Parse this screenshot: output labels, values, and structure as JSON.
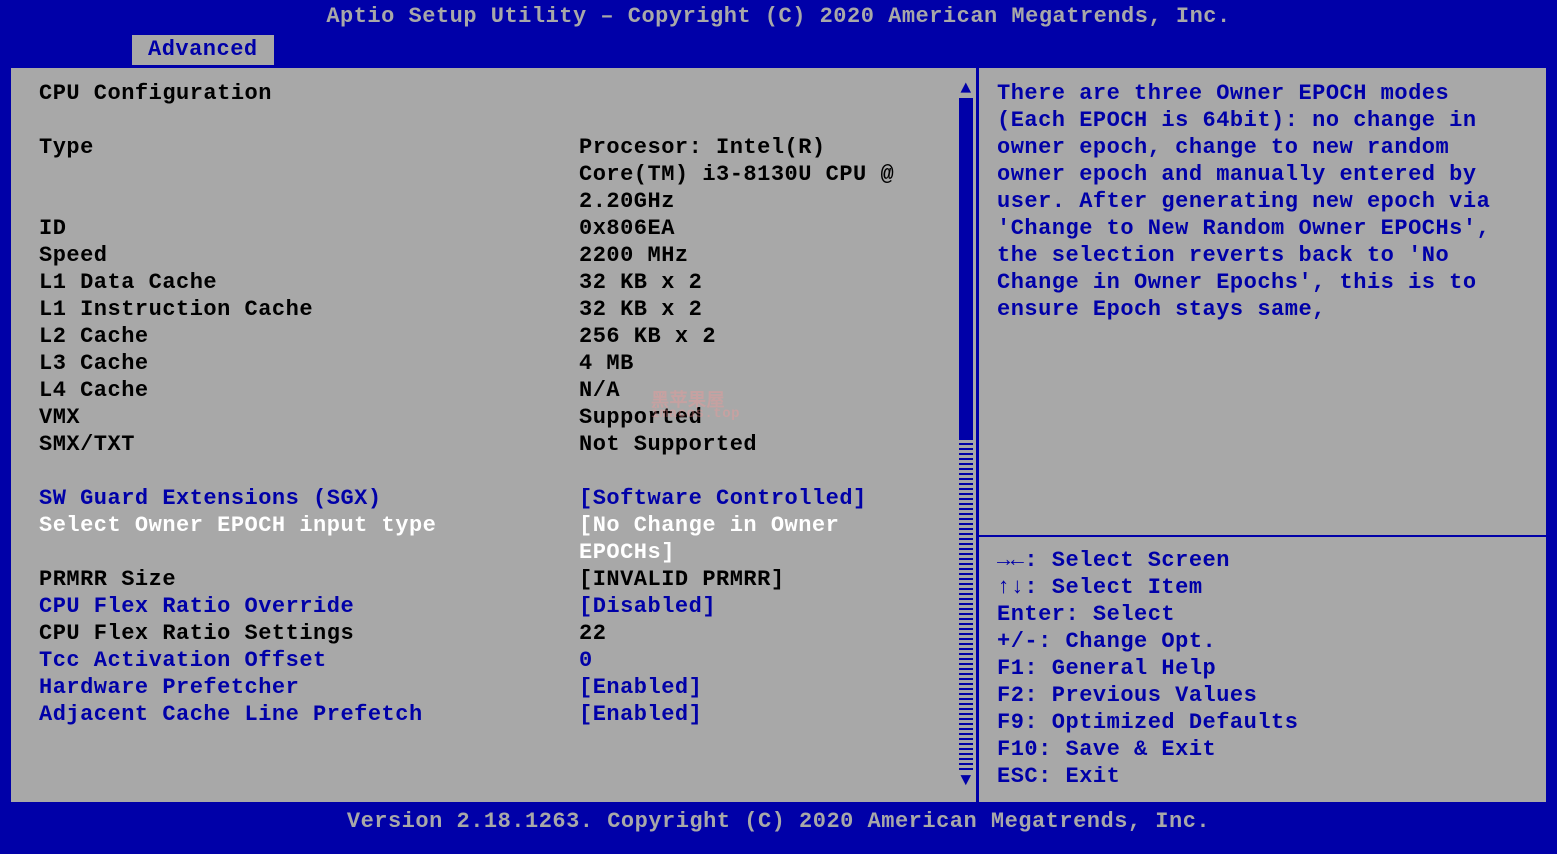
{
  "header": {
    "title": "Aptio Setup Utility – Copyright (C) 2020 American Megatrends, Inc."
  },
  "tab": {
    "active": "Advanced"
  },
  "main": {
    "section_title": "CPU Configuration",
    "info": [
      {
        "label": "Type",
        "value": "Procesor: Intel(R)"
      },
      {
        "label": "",
        "value": "Core(TM) i3-8130U CPU @"
      },
      {
        "label": "",
        "value": "2.20GHz"
      },
      {
        "label": "ID",
        "value": "0x806EA"
      },
      {
        "label": "Speed",
        "value": "2200 MHz"
      },
      {
        "label": "L1 Data Cache",
        "value": "32 KB x 2"
      },
      {
        "label": "L1 Instruction Cache",
        "value": "32 KB x 2"
      },
      {
        "label": "L2 Cache",
        "value": "256 KB x 2"
      },
      {
        "label": "L3 Cache",
        "value": "4 MB"
      },
      {
        "label": "L4 Cache",
        "value": "N/A"
      },
      {
        "label": "VMX",
        "value": "Supported"
      },
      {
        "label": "SMX/TXT",
        "value": "Not Supported"
      }
    ],
    "options": [
      {
        "label": "SW Guard Extensions (SGX)",
        "value": "[Software Controlled]",
        "kind": "option"
      },
      {
        "label": "Select Owner EPOCH input type",
        "value": "[No Change in Owner",
        "kind": "selected"
      },
      {
        "label": "",
        "value": "EPOCHs]",
        "kind": "selected"
      },
      {
        "label": "PRMRR Size",
        "value": "[INVALID PRMRR]",
        "kind": "readonly"
      },
      {
        "label": "CPU Flex Ratio Override",
        "value": "[Disabled]",
        "kind": "option"
      },
      {
        "label": "CPU Flex Ratio Settings",
        "value": "22",
        "kind": "readonly"
      },
      {
        "label": "Tcc Activation Offset",
        "value": "0",
        "kind": "option"
      },
      {
        "label": "Hardware Prefetcher",
        "value": "[Enabled]",
        "kind": "option"
      },
      {
        "label": "Adjacent Cache Line Prefetch",
        "value": "[Enabled]",
        "kind": "option"
      }
    ]
  },
  "side": {
    "help_text": "There are three Owner EPOCH modes (Each EPOCH is 64bit): no change in owner epoch, change to new random owner epoch and manually entered by user. After generating new epoch via 'Change to New Random Owner EPOCHs', the selection reverts back to 'No Change in Owner Epochs', this is to ensure Epoch stays same,",
    "keys": [
      "→←: Select Screen",
      "↑↓: Select Item",
      "Enter: Select",
      "+/-: Change Opt.",
      "F1: General Help",
      "F2: Previous Values",
      "F9: Optimized Defaults",
      "F10: Save & Exit",
      "ESC: Exit"
    ]
  },
  "footer": {
    "text": "Version 2.18.1263. Copyright (C) 2020 American Megatrends, Inc."
  }
}
